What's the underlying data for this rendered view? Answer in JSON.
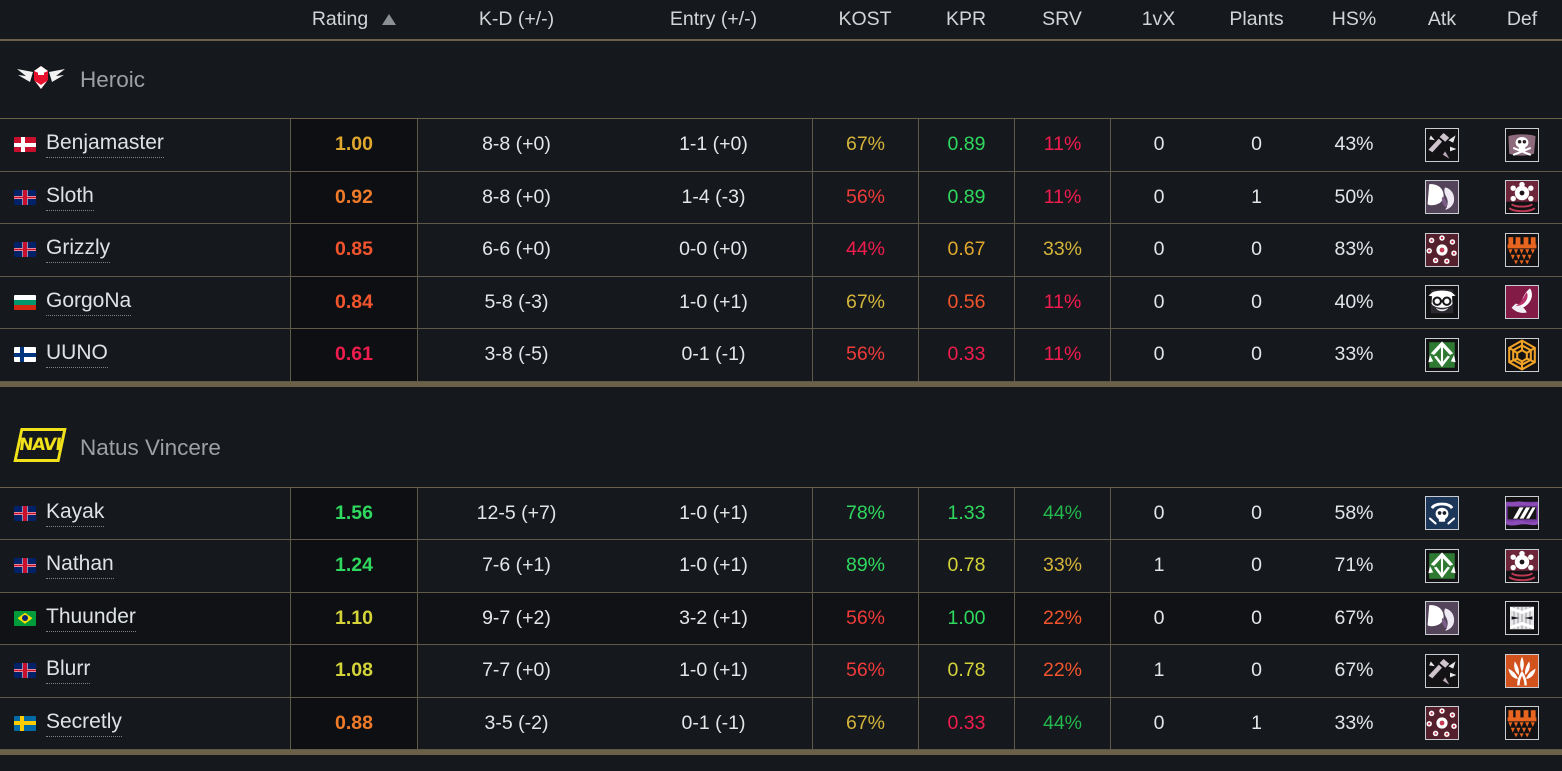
{
  "columns": [
    {
      "key": "player",
      "label": ""
    },
    {
      "key": "rating",
      "label": "Rating"
    },
    {
      "key": "kd",
      "label": "K-D (+/-)"
    },
    {
      "key": "entry",
      "label": "Entry (+/-)"
    },
    {
      "key": "kost",
      "label": "KOST"
    },
    {
      "key": "kpr",
      "label": "KPR"
    },
    {
      "key": "srv",
      "label": "SRV"
    },
    {
      "key": "onevx",
      "label": "1vX"
    },
    {
      "key": "plants",
      "label": "Plants"
    },
    {
      "key": "hs",
      "label": "HS%"
    },
    {
      "key": "atk",
      "label": "Atk"
    },
    {
      "key": "def",
      "label": "Def"
    }
  ],
  "sort": {
    "column": "Rating",
    "direction": "ascending-arrow",
    "icon": "sort-arrow-up-icon"
  },
  "colors": {
    "background": "#15181c",
    "row_alt": "#101215",
    "rating_cell_bg": "#0d0f12",
    "border": "#5f5948",
    "border_strong": "#6b6149",
    "text": "#e3e5e7",
    "header_text": "#d2d4d6",
    "team_name": "#9ca0a4",
    "green": "#2fd85f",
    "green_dark": "#23b84e",
    "yellow": "#d4d43a",
    "gold": "#e0a82e",
    "orange": "#f07b2a",
    "orange_red": "#f2542d",
    "red": "#ef3b3b",
    "crimson": "#f01c4e",
    "heroic_red": "#e8112d",
    "navi_yellow": "#f0e11a"
  },
  "teams": [
    {
      "name": "Heroic",
      "logo": "heroic-logo",
      "players": [
        {
          "name": "Benjamaster",
          "flag": "dk",
          "flag_name": "denmark-flag",
          "rating": "1.00",
          "rating_color": "#e0a82e",
          "kd": "8-8 (+0)",
          "entry": "1-1 (+0)",
          "kost": "67%",
          "kost_color": "#d4b43a",
          "kpr": "0.89",
          "kpr_color": "#2fd85f",
          "srv": "11%",
          "srv_color": "#f01c4e",
          "onevx": "0",
          "plants": "0",
          "hs": "43%",
          "atk_op": "sledge-icon",
          "def_op": "caveira-icon"
        },
        {
          "name": "Sloth",
          "flag": "gb",
          "flag_name": "united-kingdom-flag",
          "rating": "0.92",
          "rating_color": "#f07b2a",
          "kd": "8-8 (+0)",
          "entry": "1-4 (-3)",
          "kost": "56%",
          "kost_color": "#ef3b3b",
          "kpr": "0.89",
          "kpr_color": "#2fd85f",
          "srv": "11%",
          "srv_color": "#f01c4e",
          "onevx": "0",
          "plants": "1",
          "hs": "50%",
          "atk_op": "nomad-icon",
          "def_op": "mute-icon"
        },
        {
          "name": "Grizzly",
          "flag": "gb",
          "flag_name": "united-kingdom-flag",
          "rating": "0.85",
          "rating_color": "#f2542d",
          "kd": "6-6 (+0)",
          "entry": "0-0 (+0)",
          "kost": "44%",
          "kost_color": "#f01c4e",
          "kpr": "0.67",
          "kpr_color": "#e0a82e",
          "srv": "33%",
          "srv_color": "#d4b43a",
          "onevx": "0",
          "plants": "0",
          "hs": "83%",
          "atk_op": "thatcher-icon",
          "def_op": "castle-icon"
        },
        {
          "name": "GorgoNa",
          "flag": "bg",
          "flag_name": "bulgaria-flag",
          "rating": "0.84",
          "rating_color": "#f2542d",
          "kd": "5-8 (-3)",
          "entry": "1-0 (+1)",
          "kost": "67%",
          "kost_color": "#d4b43a",
          "kpr": "0.56",
          "kpr_color": "#f2542d",
          "srv": "11%",
          "srv_color": "#f01c4e",
          "onevx": "0",
          "plants": "0",
          "hs": "40%",
          "atk_op": "ying-icon",
          "def_op": "doc-icon"
        },
        {
          "name": "UUNO",
          "flag": "fi",
          "flag_name": "finland-flag",
          "rating": "0.61",
          "rating_color": "#f01c4e",
          "kd": "3-8 (-5)",
          "entry": "0-1 (-1)",
          "kost": "56%",
          "kost_color": "#ef3b3b",
          "kpr": "0.33",
          "kpr_color": "#f01c4e",
          "srv": "11%",
          "srv_color": "#f01c4e",
          "onevx": "0",
          "plants": "0",
          "hs": "33%",
          "atk_op": "zofia-icon",
          "def_op": "mira-icon"
        }
      ]
    },
    {
      "name": "Natus Vincere",
      "logo": "navi-logo",
      "logo_text": "NAVI",
      "players": [
        {
          "name": "Kayak",
          "flag": "gb",
          "flag_name": "united-kingdom-flag",
          "rating": "1.56",
          "rating_color": "#2fd85f",
          "kd": "12-5 (+7)",
          "entry": "1-0 (+1)",
          "kost": "78%",
          "kost_color": "#2fd85f",
          "kpr": "1.33",
          "kpr_color": "#2fd85f",
          "srv": "44%",
          "srv_color": "#23b84e",
          "onevx": "0",
          "plants": "0",
          "hs": "58%",
          "atk_op": "ash-icon",
          "def_op": "kaid-icon"
        },
        {
          "name": "Nathan",
          "flag": "gb",
          "flag_name": "united-kingdom-flag",
          "rating": "1.24",
          "rating_color": "#2fd85f",
          "kd": "7-6 (+1)",
          "entry": "1-0 (+1)",
          "kost": "89%",
          "kost_color": "#2fd85f",
          "kpr": "0.78",
          "kpr_color": "#d4d43a",
          "srv": "33%",
          "srv_color": "#d4b43a",
          "onevx": "1",
          "plants": "0",
          "hs": "71%",
          "atk_op": "zofia-icon",
          "def_op": "mute-icon"
        },
        {
          "name": "Thuunder",
          "flag": "br",
          "flag_name": "brazil-flag",
          "rating": "1.10",
          "rating_color": "#d4d43a",
          "kd": "9-7 (+2)",
          "entry": "3-2 (+1)",
          "kost": "56%",
          "kost_color": "#ef3b3b",
          "kpr": "1.00",
          "kpr_color": "#2fd85f",
          "srv": "22%",
          "srv_color": "#f2542d",
          "onevx": "0",
          "plants": "0",
          "hs": "67%",
          "atk_op": "nomad-icon",
          "def_op": "clash-icon"
        },
        {
          "name": "Blurr",
          "flag": "gb",
          "flag_name": "united-kingdom-flag",
          "rating": "1.08",
          "rating_color": "#d4d43a",
          "kd": "7-7 (+0)",
          "entry": "1-0 (+1)",
          "kost": "56%",
          "kost_color": "#ef3b3b",
          "kpr": "0.78",
          "kpr_color": "#d4d43a",
          "srv": "22%",
          "srv_color": "#f2542d",
          "onevx": "1",
          "plants": "0",
          "hs": "67%",
          "atk_op": "sledge-icon",
          "def_op": "goyo-icon"
        },
        {
          "name": "Secretly",
          "flag": "se",
          "flag_name": "sweden-flag",
          "rating": "0.88",
          "rating_color": "#f07b2a",
          "kd": "3-5 (-2)",
          "entry": "0-1 (-1)",
          "kost": "67%",
          "kost_color": "#d4b43a",
          "kpr": "0.33",
          "kpr_color": "#f01c4e",
          "srv": "44%",
          "srv_color": "#23b84e",
          "onevx": "0",
          "plants": "1",
          "hs": "33%",
          "atk_op": "thatcher-icon",
          "def_op": "castle-icon"
        }
      ]
    }
  ]
}
